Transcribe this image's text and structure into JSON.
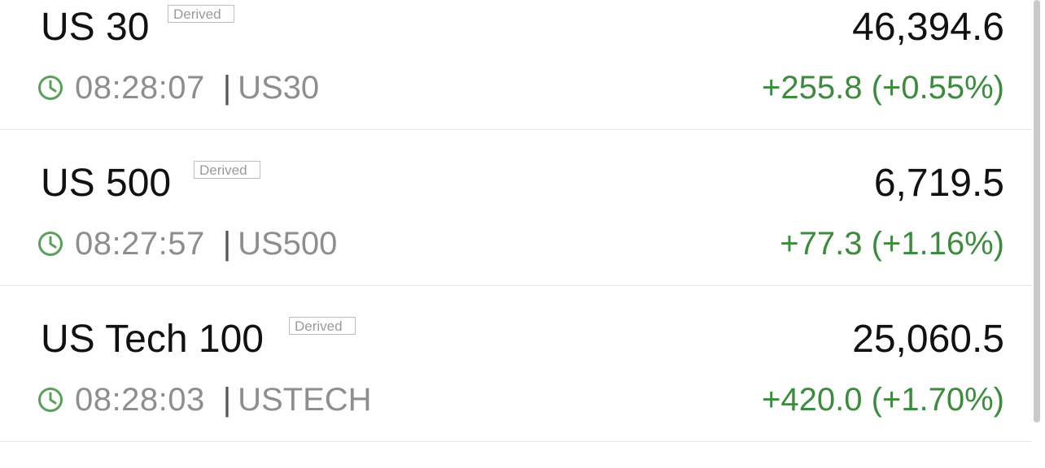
{
  "colors": {
    "positive": "#3d8b3d",
    "clock_icon": "#5aa05a",
    "muted_text": "#8e8e8e"
  },
  "instruments": [
    {
      "name": "US 30",
      "badge": "Derived",
      "price": "46,394.6",
      "time": "08:28:07",
      "symbol": "US30",
      "change": "+255.8 (+0.55%)",
      "icon": "clock-icon"
    },
    {
      "name": "US 500",
      "badge": "Derived",
      "price": "6,719.5",
      "time": "08:27:57",
      "symbol": "US500",
      "change": "+77.3 (+1.16%)",
      "icon": "clock-icon"
    },
    {
      "name": "US Tech 100",
      "badge": "Derived",
      "price": "25,060.5",
      "time": "08:28:03",
      "symbol": "USTECH",
      "change": "+420.0 (+1.70%)",
      "icon": "clock-icon"
    }
  ]
}
